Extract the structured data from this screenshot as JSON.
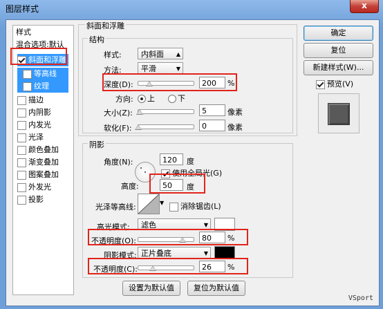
{
  "window": {
    "title": "图层样式",
    "close": "x"
  },
  "left_panel": {
    "items": [
      {
        "label": "样式",
        "checkbox": false,
        "checked": false
      },
      {
        "label": "混合选项:默认",
        "checkbox": false,
        "checked": false
      },
      {
        "label": "斜面和浮雕",
        "checkbox": true,
        "checked": true,
        "selected": true
      },
      {
        "label": "等高线",
        "checkbox": true,
        "checked": false
      },
      {
        "label": "纹理",
        "checkbox": true,
        "checked": false
      },
      {
        "label": "描边",
        "checkbox": true,
        "checked": false
      },
      {
        "label": "内阴影",
        "checkbox": true,
        "checked": false
      },
      {
        "label": "内发光",
        "checkbox": true,
        "checked": false
      },
      {
        "label": "光泽",
        "checkbox": true,
        "checked": false
      },
      {
        "label": "颜色叠加",
        "checkbox": true,
        "checked": false
      },
      {
        "label": "渐变叠加",
        "checkbox": true,
        "checked": false
      },
      {
        "label": "图案叠加",
        "checkbox": true,
        "checked": false
      },
      {
        "label": "外发光",
        "checkbox": true,
        "checked": false
      },
      {
        "label": "投影",
        "checkbox": true,
        "checked": false
      }
    ]
  },
  "bevel": {
    "group_title": "斜面和浮雕",
    "structure_title": "结构",
    "style_label": "样式:",
    "style_value": "内斜面",
    "technique_label": "方法:",
    "technique_value": "平滑",
    "depth_label": "深度(D):",
    "depth_value": "200",
    "depth_unit": "%",
    "depth_fraction": 0.2,
    "direction_label": "方向:",
    "direction_up": "上",
    "direction_down": "下",
    "size_label": "大小(Z):",
    "size_value": "5",
    "size_unit": "像素",
    "size_fraction": 0.02,
    "soften_label": "软化(F):",
    "soften_value": "0",
    "soften_unit": "像素",
    "soften_fraction": 0.0
  },
  "shading": {
    "title": "阴影",
    "angle_label": "角度(N):",
    "angle_value": "120",
    "angle_unit": "度",
    "global_light_label": "使用全局光(G)",
    "global_light_checked": true,
    "altitude_label": "高度:",
    "altitude_value": "50",
    "altitude_unit": "度",
    "gloss_contour_label": "光泽等高线:",
    "antialias_label": "消除锯齿(L)",
    "highlight_mode_label": "高光模式:",
    "highlight_mode_value": "滤色",
    "highlight_color": "#ffffff",
    "highlight_opacity_label": "不透明度(O):",
    "highlight_opacity_value": "80",
    "highlight_opacity_fraction": 0.8,
    "shadow_mode_label": "阴影模式:",
    "shadow_mode_value": "正片叠底",
    "shadow_color": "#000000",
    "shadow_opacity_label": "不透明度(C):",
    "shadow_opacity_value": "26",
    "shadow_opacity_fraction": 0.26,
    "percent": "%"
  },
  "footer": {
    "set_default": "设置为默认值",
    "reset_default": "复位为默认值"
  },
  "right_panel": {
    "ok": "确定",
    "reset": "复位",
    "new_style": "新建样式(W)...",
    "preview_label": "预览(V)",
    "preview_checked": true
  },
  "watermark": "VSport",
  "colors": {
    "accent_red": "#e2231a",
    "selection_blue": "#3399ff"
  }
}
